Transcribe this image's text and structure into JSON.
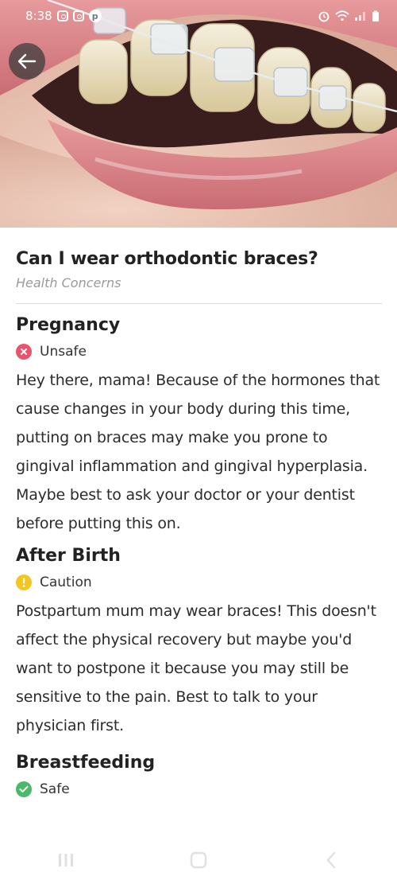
{
  "status_bar": {
    "time": "8:38"
  },
  "hero": {
    "back_icon": "arrow-left-icon"
  },
  "article": {
    "title": "Can I wear orthodontic braces?",
    "category": "Health Concerns"
  },
  "sections": [
    {
      "title": "Pregnancy",
      "status": "Unsafe",
      "status_color": "#e8546b",
      "status_icon": "x-circle-icon",
      "body": "Hey there, mama! Because of the hormones that cause changes in your body during this time, putting on braces may make you prone to gingival inflammation and gingival hyperplasia. Maybe best to ask your doctor or your dentist before putting this on."
    },
    {
      "title": "After Birth",
      "status": "Caution",
      "status_color": "#f5c524",
      "status_icon": "exclamation-circle-icon",
      "body": "Postpartum mum may wear braces! This doesn't affect the physical recovery but maybe you'd want to postpone it because you may still be sensitive to the pain. Best to talk to your physician first."
    },
    {
      "title": "Breastfeeding",
      "status": "Safe",
      "status_color": "#4cb86a",
      "status_icon": "check-circle-icon"
    }
  ]
}
